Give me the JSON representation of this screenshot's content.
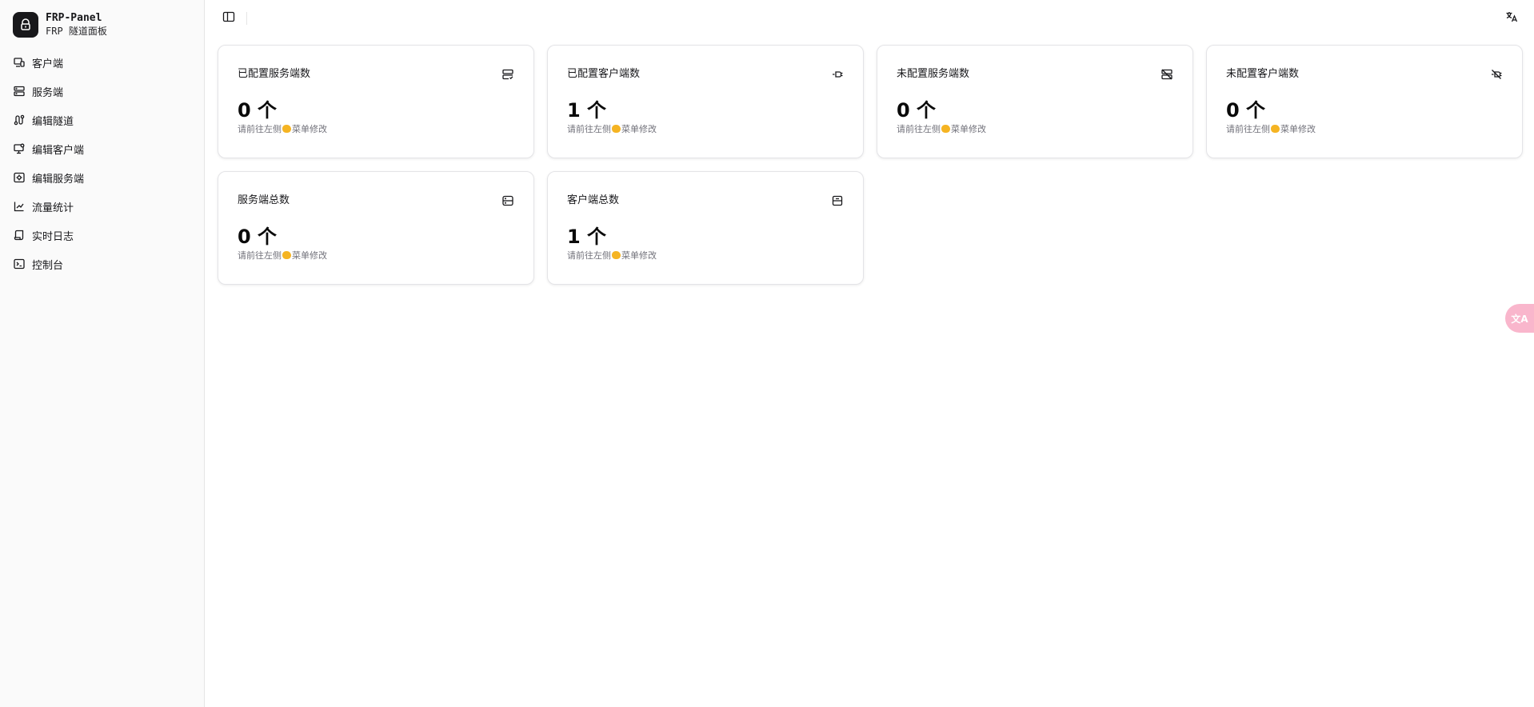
{
  "brand": {
    "title": "FRP-Panel",
    "subtitle": "FRP 隧道面板",
    "logo_icon": "lock-shield-icon"
  },
  "sidebar": {
    "items": [
      {
        "label": "客户端",
        "icon": "monitor-smartphone-icon"
      },
      {
        "label": "服务端",
        "icon": "server-icon"
      },
      {
        "label": "编辑隧道",
        "icon": "route-icon"
      },
      {
        "label": "编辑客户端",
        "icon": "monitor-cog-icon"
      },
      {
        "label": "编辑服务端",
        "icon": "server-cog-icon"
      },
      {
        "label": "流量统计",
        "icon": "chart-icon"
      },
      {
        "label": "实时日志",
        "icon": "scroll-icon"
      },
      {
        "label": "控制台",
        "icon": "terminal-icon"
      }
    ]
  },
  "topbar": {
    "toggle_icon": "panel-left-icon",
    "lang_icon": "languages-icon"
  },
  "cards": [
    {
      "title": "已配置服务端数",
      "value": "0 个",
      "hint_before": "请前往左侧",
      "hint_after": "菜单修改",
      "icon": "server-check-icon"
    },
    {
      "title": "已配置客户端数",
      "value": "1 个",
      "hint_before": "请前往左侧",
      "hint_after": "菜单修改",
      "icon": "plug-icon"
    },
    {
      "title": "未配置服务端数",
      "value": "0 个",
      "hint_before": "请前往左侧",
      "hint_after": "菜单修改",
      "icon": "server-off-icon"
    },
    {
      "title": "未配置客户端数",
      "value": "0 个",
      "hint_before": "请前往左侧",
      "hint_after": "菜单修改",
      "icon": "plug-off-icon"
    },
    {
      "title": "服务端总数",
      "value": "0 个",
      "hint_before": "请前往左侧",
      "hint_after": "菜单修改",
      "icon": "server-icon"
    },
    {
      "title": "客户端总数",
      "value": "1 个",
      "hint_before": "请前往左侧",
      "hint_after": "菜单修改",
      "icon": "monitor-icon"
    }
  ],
  "floating": {
    "label": "文A"
  },
  "colors": {
    "sidebar_bg": "#fafafa",
    "hand_emoji": "#f5b423",
    "float_button": "#f9b6cc"
  }
}
